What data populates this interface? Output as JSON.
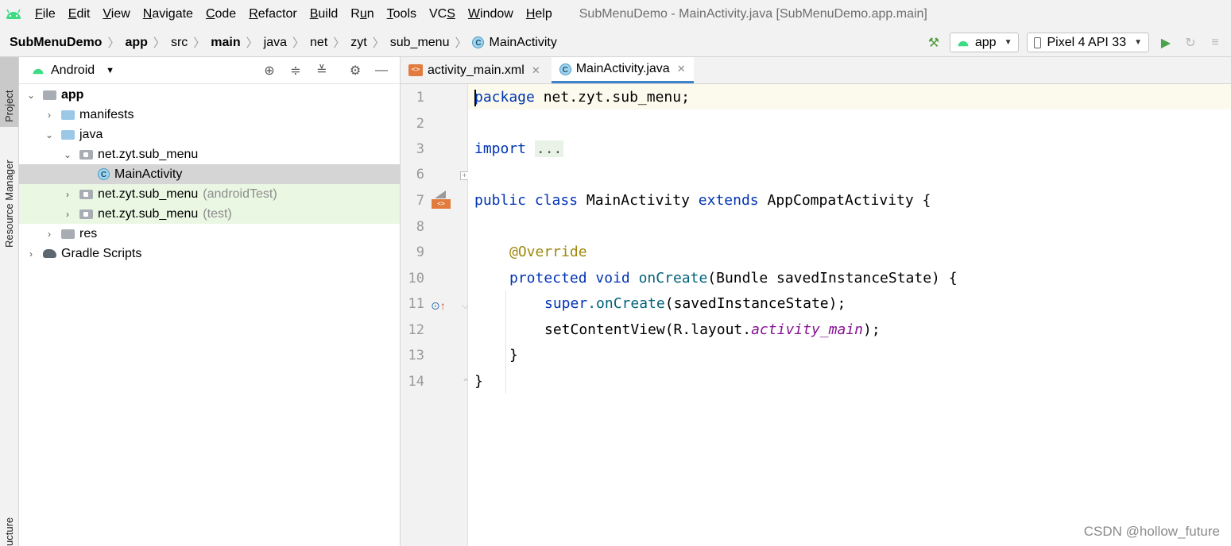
{
  "menu": {
    "items": [
      {
        "pre": "",
        "u": "F",
        "post": "ile"
      },
      {
        "pre": "",
        "u": "E",
        "post": "dit"
      },
      {
        "pre": "",
        "u": "V",
        "post": "iew"
      },
      {
        "pre": "",
        "u": "N",
        "post": "avigate"
      },
      {
        "pre": "",
        "u": "C",
        "post": "ode"
      },
      {
        "pre": "",
        "u": "R",
        "post": "efactor"
      },
      {
        "pre": "",
        "u": "B",
        "post": "uild"
      },
      {
        "pre": "R",
        "u": "u",
        "post": "n"
      },
      {
        "pre": "",
        "u": "T",
        "post": "ools"
      },
      {
        "pre": "VC",
        "u": "S",
        "post": ""
      },
      {
        "pre": "",
        "u": "W",
        "post": "indow"
      },
      {
        "pre": "",
        "u": "H",
        "post": "elp"
      }
    ],
    "window_title": "SubMenuDemo - MainActivity.java [SubMenuDemo.app.main]"
  },
  "breadcrumb": [
    "SubMenuDemo",
    "app",
    "src",
    "main",
    "java",
    "net",
    "zyt",
    "sub_menu",
    "MainActivity"
  ],
  "toolbar": {
    "run_config": "app",
    "device": "Pixel 4 API 33"
  },
  "stripe": {
    "project": "Project",
    "resource_manager": "Resource Manager",
    "structure": "ucture"
  },
  "project_panel": {
    "view_mode": "Android",
    "tree": {
      "app": "app",
      "manifests": "manifests",
      "java": "java",
      "pkg_main": "net.zyt.sub_menu",
      "main_activity": "MainActivity",
      "pkg_android_test": "net.zyt.sub_menu",
      "android_test_suffix": "(androidTest)",
      "pkg_test": "net.zyt.sub_menu",
      "test_suffix": "(test)",
      "res": "res",
      "gradle": "Gradle Scripts"
    }
  },
  "editor": {
    "tabs": [
      {
        "label": "activity_main.xml",
        "icon": "xml-layout-icon"
      },
      {
        "label": "MainActivity.java",
        "icon": "class-icon",
        "active": true
      }
    ],
    "line_numbers": [
      "1",
      "2",
      "3",
      "6",
      "7",
      "8",
      "9",
      "10",
      "11",
      "12",
      "13",
      "14"
    ],
    "code": {
      "l1_kw": "package",
      "l1_rest": " net.zyt.sub_menu;",
      "l3_kw": "import",
      "l3_folded": "...",
      "l7_kw1": "public",
      "l7_kw2": "class",
      "l7_name": " MainActivity ",
      "l7_kw3": "extends",
      "l7_rest": " AppCompatActivity {",
      "l9_ann": "@Override",
      "l10_kw1": "protected",
      "l10_kw2": "void",
      "l10_fn": "onCreate",
      "l10_rest": "(Bundle savedInstanceState) {",
      "l11_kw": "super",
      "l11_fn": ".onCreate",
      "l11_rest": "(savedInstanceState);",
      "l12_pre": "setContentView(R.layout.",
      "l12_field": "activity_main",
      "l12_post": ");",
      "l13": "}",
      "l14": "}"
    }
  },
  "watermark": "CSDN @hollow_future",
  "colors": {
    "keyword": "#0033b3",
    "annotation": "#9e880d",
    "method": "#00627a",
    "field": "#871094",
    "android_green": "#3ddc84"
  }
}
